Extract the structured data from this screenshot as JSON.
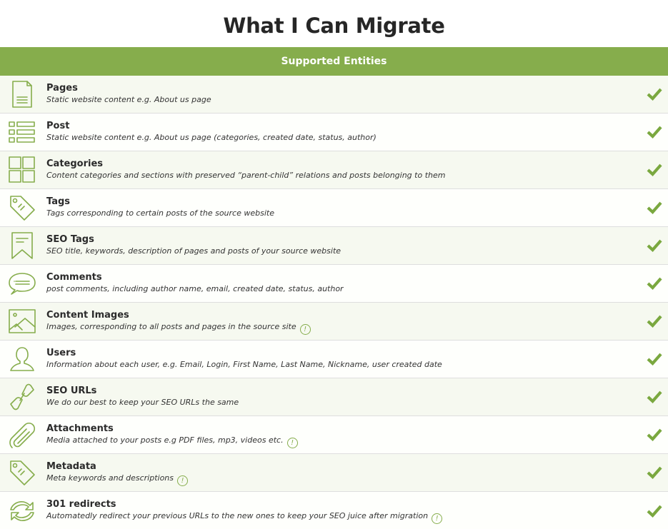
{
  "page": {
    "title": "What I Can Migrate"
  },
  "table": {
    "header": "Supported Entities",
    "colors": {
      "accent": "#86ad4c",
      "check": "#7aa83f",
      "row_odd": "#f6f9f0",
      "row_even": "#fefffc"
    },
    "rows": [
      {
        "name": "Pages",
        "description": "Static website content e.g. About us page",
        "icon": "document-icon",
        "info": false,
        "supported": true,
        "info_glyph": ""
      },
      {
        "name": "Post",
        "description": "Static website content e.g. About us page (categories, created date, status, author)",
        "icon": "list-icon",
        "info": false,
        "supported": true,
        "info_glyph": ""
      },
      {
        "name": "Categories",
        "description": "Content categories and sections with preserved “parent-child” relations and posts belonging to them",
        "icon": "grid-icon",
        "info": false,
        "supported": true,
        "info_glyph": ""
      },
      {
        "name": "Tags",
        "description": "Tags corresponding to certain posts of the source website",
        "icon": "tag-icon",
        "info": false,
        "supported": true,
        "info_glyph": ""
      },
      {
        "name": "SEO Tags",
        "description": "SEO title, keywords, description of pages and posts of your source website",
        "icon": "bookmark-icon",
        "info": false,
        "supported": true,
        "info_glyph": ""
      },
      {
        "name": "Comments",
        "description": "post comments, including author name, email, created date, status, author",
        "icon": "speech-bubble-icon",
        "info": false,
        "supported": true,
        "info_glyph": ""
      },
      {
        "name": "Content Images",
        "description": "Images, corresponding to all posts and pages in the source site",
        "icon": "image-icon",
        "info": true,
        "supported": true,
        "info_glyph": "!"
      },
      {
        "name": "Users",
        "description": "Information about each user, e.g. Email, Login, First Name, Last Name, Nickname, user created date",
        "icon": "user-icon",
        "info": false,
        "supported": true,
        "info_glyph": ""
      },
      {
        "name": "SEO URLs",
        "description": "We do our best to keep your SEO URLs the same",
        "icon": "link-icon",
        "info": false,
        "supported": true,
        "info_glyph": ""
      },
      {
        "name": "Attachments",
        "description": "Media attached to your posts e.g PDF files, mp3, videos etc.",
        "icon": "paperclip-icon",
        "info": true,
        "supported": true,
        "info_glyph": "!"
      },
      {
        "name": "Metadata",
        "description": "Meta keywords and descriptions",
        "icon": "tag-icon",
        "info": true,
        "supported": true,
        "info_glyph": "!"
      },
      {
        "name": "301 redirects",
        "description": "Automatedly redirect your previous URLs to the new ones to keep your SEO juice after migration",
        "icon": "refresh-arrows-icon",
        "info": true,
        "supported": true,
        "info_glyph": "!"
      }
    ]
  }
}
